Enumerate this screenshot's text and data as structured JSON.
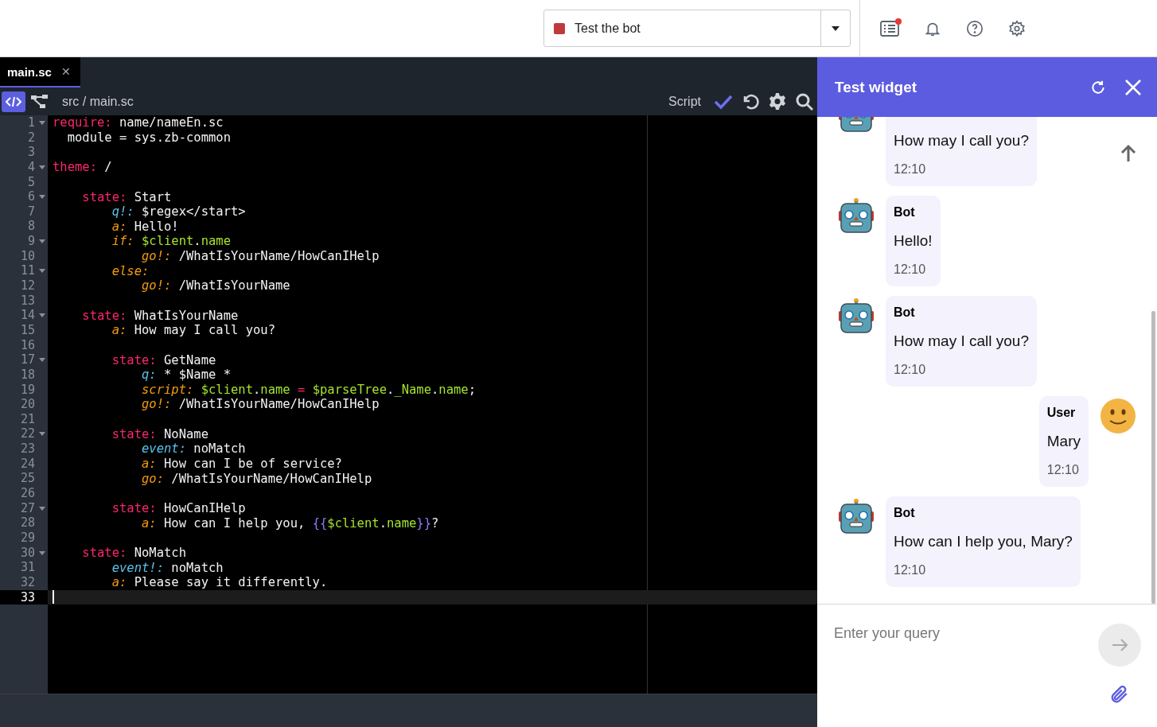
{
  "topbar": {
    "bot_selector": {
      "label": "Test the bot"
    }
  },
  "editor": {
    "tabs": [
      {
        "label": "main.sc",
        "close": "✕",
        "selected": true
      }
    ],
    "toolbar": {
      "path": "src / main.sc",
      "mode": "Script"
    },
    "lines": [
      {
        "number": "1",
        "fold": true,
        "current": false,
        "tokens": [
          {
            "kind": "keyword",
            "text": "require:"
          },
          {
            "kind": "plain",
            "text": " name/nameEn.sc"
          }
        ]
      },
      {
        "number": "2",
        "fold": false,
        "current": false,
        "tokens": [
          {
            "kind": "plain",
            "text": "  module = sys.zb-common"
          }
        ]
      },
      {
        "number": "3",
        "fold": false,
        "current": false
      },
      {
        "number": "4",
        "fold": true,
        "current": false,
        "tokens": [
          {
            "kind": "keyword",
            "text": "theme:"
          },
          {
            "kind": "plain",
            "text": " /"
          }
        ]
      },
      {
        "number": "5",
        "fold": false,
        "current": false
      },
      {
        "number": "6",
        "fold": true,
        "current": false,
        "tokens": [
          {
            "kind": "keyword",
            "text": "    state:"
          },
          {
            "kind": "plain",
            "text": " Start"
          }
        ]
      },
      {
        "number": "7",
        "fold": false,
        "current": false,
        "tokens": [
          {
            "kind": "event",
            "text": "        q!:"
          },
          {
            "kind": "plain",
            "text": " $regex</start>"
          }
        ]
      },
      {
        "number": "8",
        "fold": false,
        "current": false,
        "tokens": [
          {
            "kind": "directive",
            "text": "        a:"
          },
          {
            "kind": "plain",
            "text": " Hello!"
          }
        ]
      },
      {
        "number": "9",
        "fold": true,
        "current": false,
        "tokens": [
          {
            "kind": "directive",
            "text": "        if:"
          },
          {
            "kind": "variable",
            "text": " $client"
          },
          {
            "kind": "plain",
            "text": "."
          },
          {
            "kind": "variable",
            "text": "name"
          }
        ]
      },
      {
        "number": "10",
        "fold": false,
        "current": false,
        "tokens": [
          {
            "kind": "directive",
            "text": "            go!:"
          },
          {
            "kind": "plain",
            "text": " /WhatIsYourName/HowCanIHelp"
          }
        ]
      },
      {
        "number": "11",
        "fold": true,
        "current": false,
        "tokens": [
          {
            "kind": "directive",
            "text": "        else:"
          }
        ]
      },
      {
        "number": "12",
        "fold": false,
        "current": false,
        "tokens": [
          {
            "kind": "directive",
            "text": "            go!:"
          },
          {
            "kind": "plain",
            "text": " /WhatIsYourName"
          }
        ]
      },
      {
        "number": "13",
        "fold": false,
        "current": false
      },
      {
        "number": "14",
        "fold": true,
        "current": false,
        "tokens": [
          {
            "kind": "keyword",
            "text": "    state:"
          },
          {
            "kind": "plain",
            "text": " WhatIsYourName"
          }
        ]
      },
      {
        "number": "15",
        "fold": false,
        "current": false,
        "tokens": [
          {
            "kind": "directive",
            "text": "        a:"
          },
          {
            "kind": "plain",
            "text": " How may I call you?"
          }
        ]
      },
      {
        "number": "16",
        "fold": false,
        "current": false
      },
      {
        "number": "17",
        "fold": true,
        "current": false,
        "tokens": [
          {
            "kind": "keyword",
            "text": "        state:"
          },
          {
            "kind": "plain",
            "text": " GetName"
          }
        ]
      },
      {
        "number": "18",
        "fold": false,
        "current": false,
        "tokens": [
          {
            "kind": "event",
            "text": "            q:"
          },
          {
            "kind": "plain",
            "text": " * $Name *"
          }
        ]
      },
      {
        "number": "19",
        "fold": false,
        "current": false,
        "tokens": [
          {
            "kind": "directive",
            "text": "            script:"
          },
          {
            "kind": "variable",
            "text": " $client"
          },
          {
            "kind": "plain",
            "text": "."
          },
          {
            "kind": "variable",
            "text": "name"
          },
          {
            "kind": "keyword",
            "text": " ="
          },
          {
            "kind": "variable",
            "text": " $parseTree"
          },
          {
            "kind": "plain",
            "text": "."
          },
          {
            "kind": "variable",
            "text": "_Name"
          },
          {
            "kind": "plain",
            "text": "."
          },
          {
            "kind": "variable",
            "text": "name"
          },
          {
            "kind": "plain",
            "text": ";"
          }
        ]
      },
      {
        "number": "20",
        "fold": false,
        "current": false,
        "tokens": [
          {
            "kind": "directive",
            "text": "            go!:"
          },
          {
            "kind": "plain",
            "text": " /WhatIsYourName/HowCanIHelp"
          }
        ]
      },
      {
        "number": "21",
        "fold": false,
        "current": false
      },
      {
        "number": "22",
        "fold": true,
        "current": false,
        "tokens": [
          {
            "kind": "keyword",
            "text": "        state:"
          },
          {
            "kind": "plain",
            "text": " NoName"
          }
        ]
      },
      {
        "number": "23",
        "fold": false,
        "current": false,
        "tokens": [
          {
            "kind": "event",
            "text": "            event:"
          },
          {
            "kind": "plain",
            "text": " noMatch"
          }
        ]
      },
      {
        "number": "24",
        "fold": false,
        "current": false,
        "tokens": [
          {
            "kind": "directive",
            "text": "            a:"
          },
          {
            "kind": "plain",
            "text": " How can I be of service?"
          }
        ]
      },
      {
        "number": "25",
        "fold": false,
        "current": false,
        "tokens": [
          {
            "kind": "directive",
            "text": "            go:"
          },
          {
            "kind": "plain",
            "text": " /WhatIsYourName/HowCanIHelp"
          }
        ]
      },
      {
        "number": "26",
        "fold": false,
        "current": false
      },
      {
        "number": "27",
        "fold": true,
        "current": false,
        "tokens": [
          {
            "kind": "keyword",
            "text": "        state:"
          },
          {
            "kind": "plain",
            "text": " HowCanIHelp"
          }
        ]
      },
      {
        "number": "28",
        "fold": false,
        "current": false,
        "tokens": [
          {
            "kind": "directive",
            "text": "            a:"
          },
          {
            "kind": "plain",
            "text": " How can I help you, "
          },
          {
            "kind": "brace",
            "text": "{{"
          },
          {
            "kind": "variable",
            "text": "$client"
          },
          {
            "kind": "plain",
            "text": "."
          },
          {
            "kind": "variable",
            "text": "name"
          },
          {
            "kind": "brace",
            "text": "}}"
          },
          {
            "kind": "plain",
            "text": "?"
          }
        ]
      },
      {
        "number": "29",
        "fold": false,
        "current": false
      },
      {
        "number": "30",
        "fold": true,
        "current": false,
        "tokens": [
          {
            "kind": "keyword",
            "text": "    state:"
          },
          {
            "kind": "plain",
            "text": " NoMatch"
          }
        ]
      },
      {
        "number": "31",
        "fold": false,
        "current": false,
        "tokens": [
          {
            "kind": "event",
            "text": "        event!:"
          },
          {
            "kind": "plain",
            "text": " noMatch"
          }
        ]
      },
      {
        "number": "32",
        "fold": false,
        "current": false,
        "tokens": [
          {
            "kind": "directive",
            "text": "        a:"
          },
          {
            "kind": "plain",
            "text": " Please say it differently."
          }
        ]
      },
      {
        "number": "33",
        "fold": false,
        "current": true
      }
    ]
  },
  "widget": {
    "title": "Test widget",
    "messages": [
      {
        "kind": "bot",
        "text": "How may I call you?",
        "time": "12:10"
      },
      {
        "kind": "bot",
        "author": "Bot",
        "text": "Hello!",
        "time": "12:10"
      },
      {
        "kind": "bot",
        "author": "Bot",
        "text": "How may I call you?",
        "time": "12:10"
      },
      {
        "kind": "user",
        "author": "User",
        "text": "Mary",
        "time": "12:10"
      },
      {
        "kind": "bot",
        "author": "Bot",
        "text": "How can I help you, Mary?",
        "time": "12:10"
      }
    ],
    "input": {
      "placeholder": "Enter your query"
    }
  }
}
